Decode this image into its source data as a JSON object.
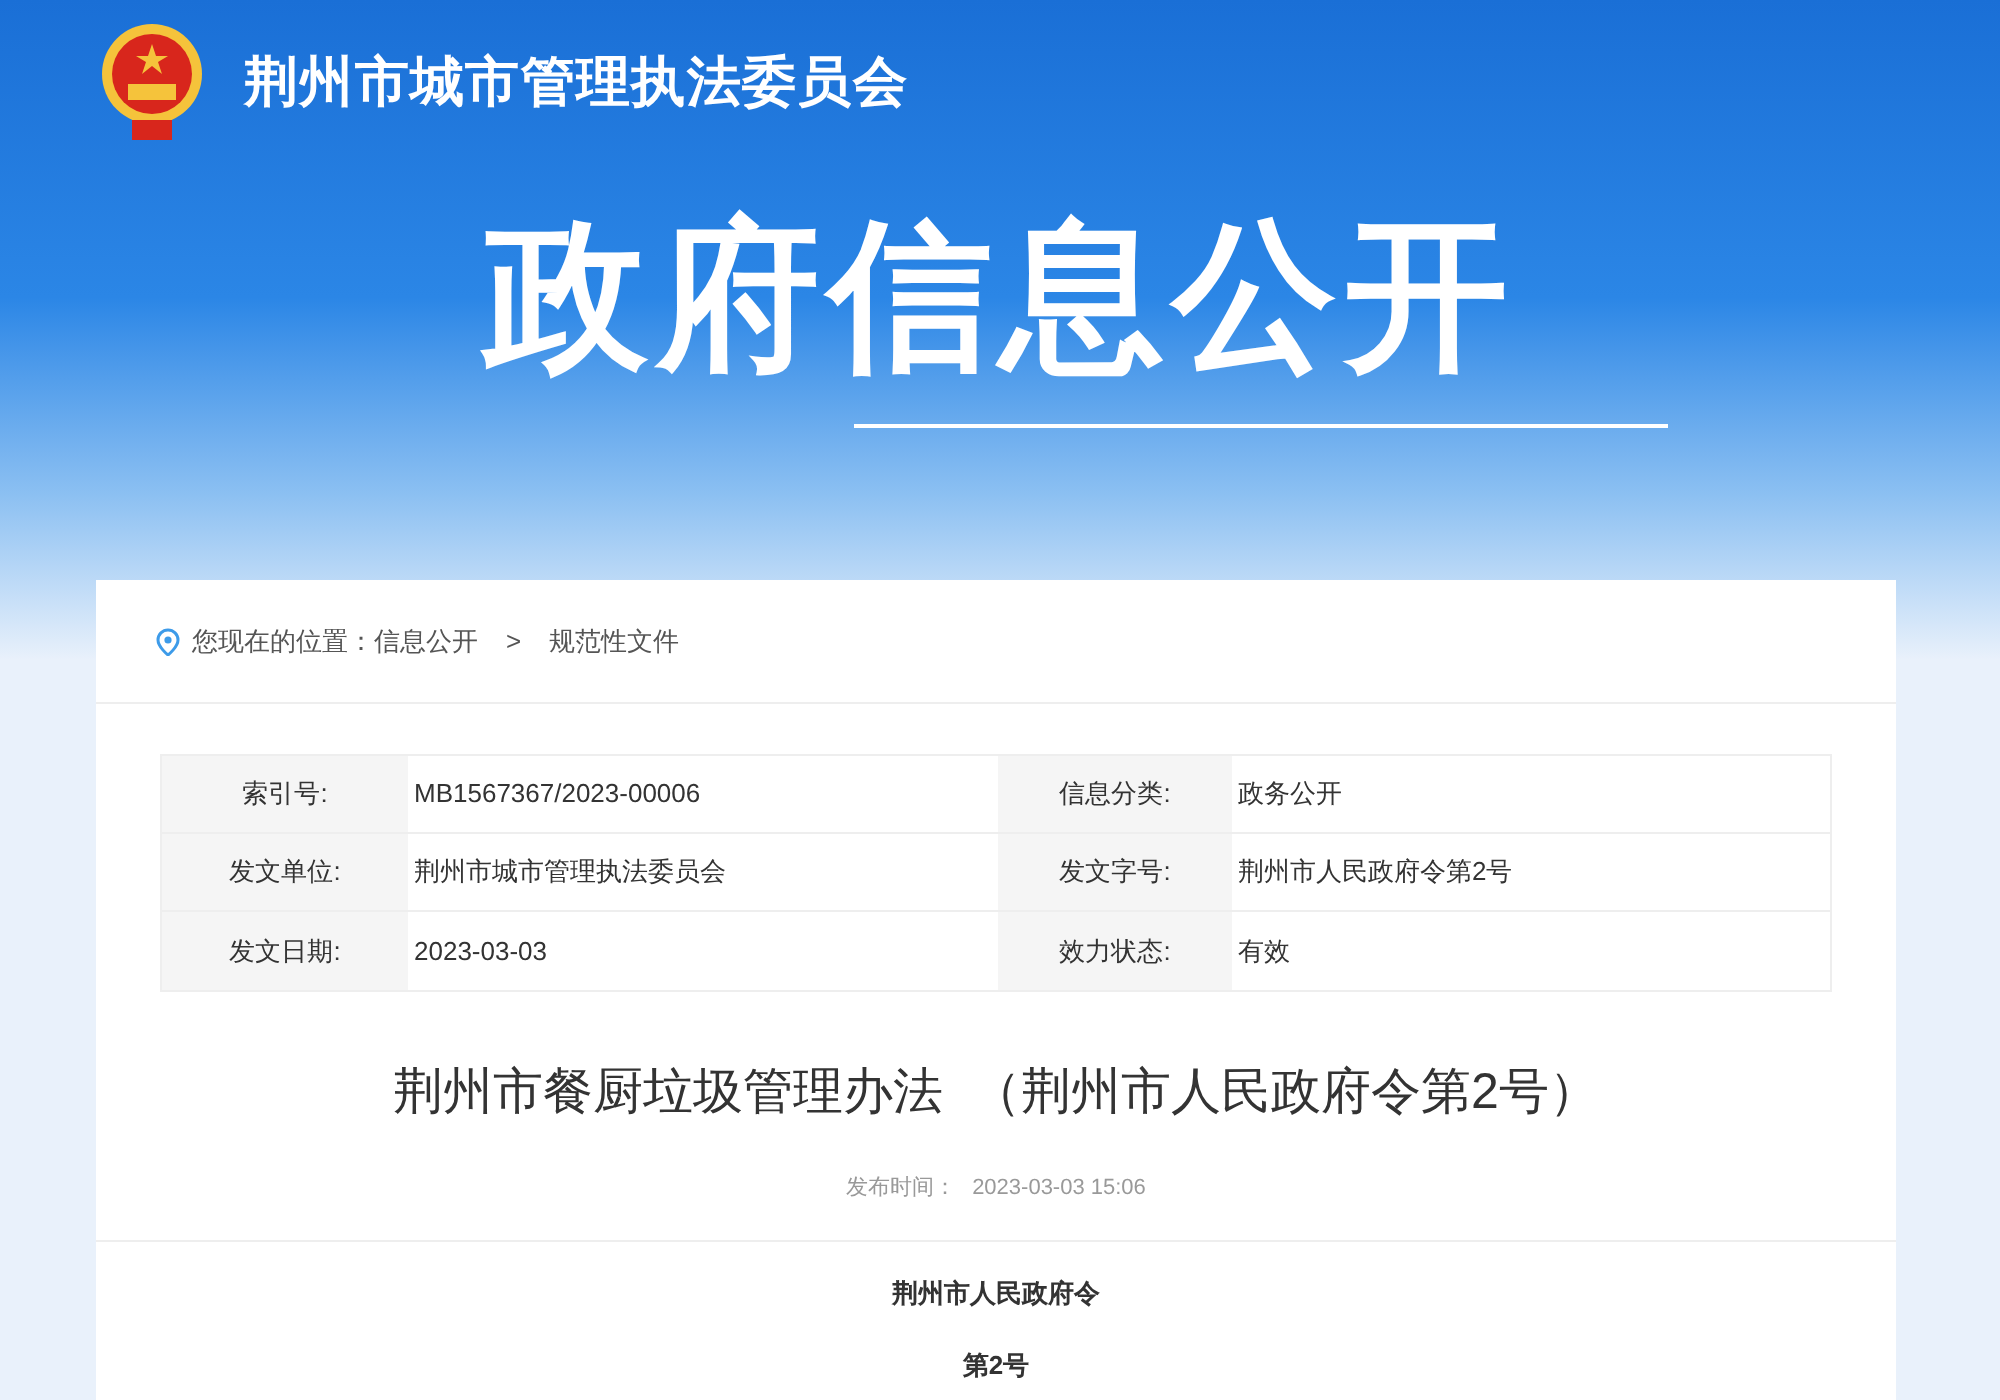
{
  "header": {
    "site_title": "荆州市城市管理执法委员会",
    "banner_title": "政府信息公开"
  },
  "breadcrumb": {
    "prefix": "您现在的位置：",
    "items": [
      {
        "label": "信息公开"
      },
      {
        "label": "规范性文件"
      }
    ],
    "separator": ">"
  },
  "info_table": [
    {
      "label": "索引号:",
      "value": "MB1567367/2023-00006"
    },
    {
      "label": "信息分类:",
      "value": "政务公开"
    },
    {
      "label": "发文单位:",
      "value": "荆州市城市管理执法委员会"
    },
    {
      "label": "发文字号:",
      "value": "荆州市人民政府令第2号"
    },
    {
      "label": "发文日期:",
      "value": "2023-03-03"
    },
    {
      "label": "效力状态:",
      "value": "有效"
    }
  ],
  "article": {
    "title": "荆州市餐厨垃圾管理办法  （荆州市人民政府令第2号）",
    "publish_label": "发布时间：",
    "publish_time": "2023-03-03 15:06",
    "body": [
      "荆州市人民政府令",
      "第2号"
    ]
  }
}
